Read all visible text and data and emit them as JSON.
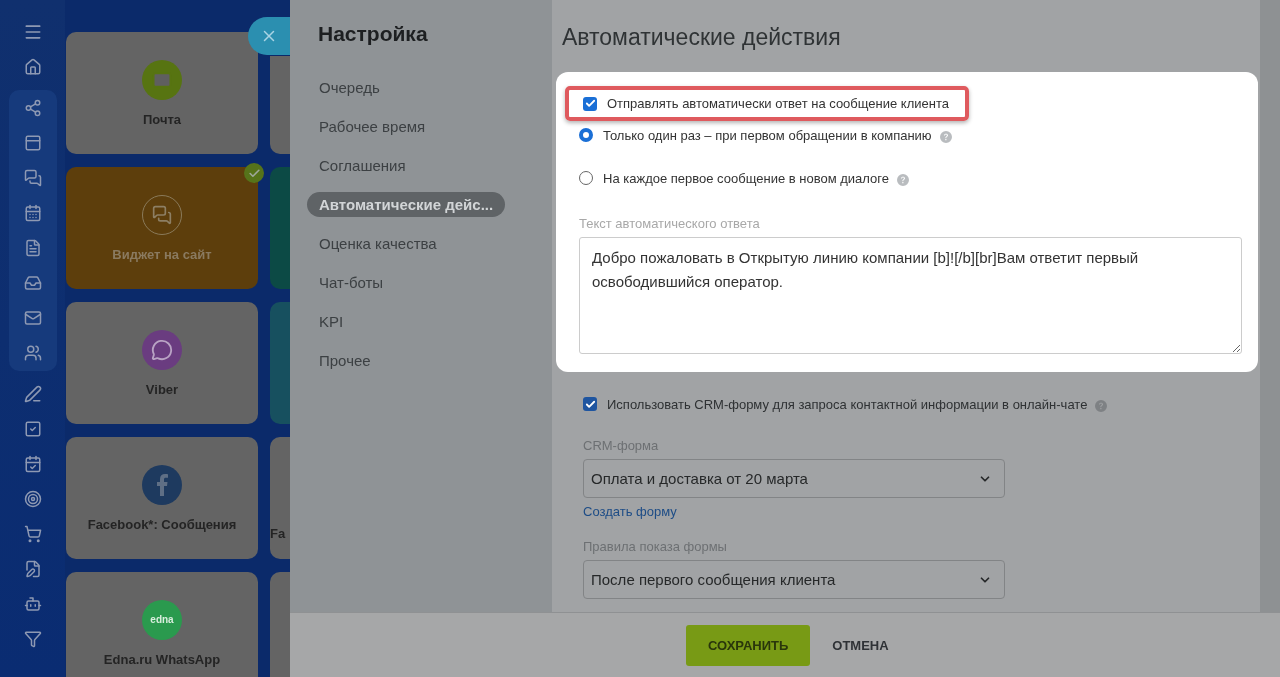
{
  "tiles": [
    {
      "label": "Почта",
      "kind": "mail",
      "connected": false
    },
    {
      "label": "Виджет на сайт",
      "kind": "widget",
      "connected": true
    },
    {
      "label": "Viber",
      "kind": "viber",
      "connected": false
    },
    {
      "label": "Facebook*: Сообщения",
      "kind": "facebook",
      "connected": false
    },
    {
      "label": "Edna.ru WhatsApp",
      "kind": "edna",
      "logo_text": "edna",
      "connected": false
    }
  ],
  "tiles_column_2": [
    {
      "color": "#646464"
    },
    {
      "color": "#0c4a45"
    },
    {
      "color": "#17505f"
    },
    {
      "color": "#646464",
      "label": "Fa"
    },
    {
      "color": "#646464"
    }
  ],
  "settings": {
    "title": "Настройка",
    "nav": [
      {
        "label": "Очередь",
        "selected": false
      },
      {
        "label": "Рабочее время",
        "selected": false
      },
      {
        "label": "Соглашения",
        "selected": false
      },
      {
        "label": "Автоматические дейс...",
        "selected": true
      },
      {
        "label": "Оценка качества",
        "selected": false
      },
      {
        "label": "Чат-боты",
        "selected": false
      },
      {
        "label": "KPI",
        "selected": false
      },
      {
        "label": "Прочее",
        "selected": false
      }
    ],
    "heading": "Автоматические действия",
    "auto_reply": {
      "label": "Отправлять автоматически ответ на сообщение клиента",
      "checked": true,
      "highlighted": true,
      "options": [
        {
          "label": "Только один раз – при первом обращении в компанию",
          "selected": true,
          "help": true
        },
        {
          "label": "На каждое первое сообщение в новом диалоге",
          "selected": false,
          "help": true
        }
      ],
      "text_label": "Текст автоматического ответа",
      "text": "Добро пожаловать в Открытую линию компании [b]![/b][br]Вам ответит первый освободившийся оператор."
    },
    "crm_form": {
      "label": "Использовать CRM-форму для запроса контактной информации в онлайн-чате",
      "checked": true,
      "help": true,
      "form_label": "CRM-форма",
      "form_value": "Оплата и доставка от 20 марта",
      "create_link": "Создать форму",
      "rule_label": "Правила показа формы",
      "rule_value": "После первого сообщения клиента"
    },
    "footer": {
      "save": "СОХРАНИТЬ",
      "cancel": "ОТМЕНА"
    }
  }
}
